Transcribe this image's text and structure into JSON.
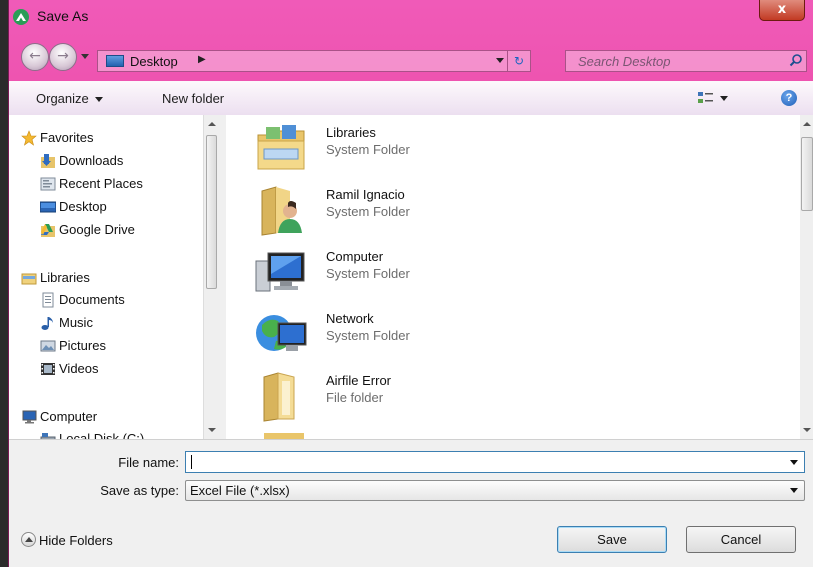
{
  "window": {
    "title": "Save As",
    "close_glyph": "x"
  },
  "navigation": {
    "back_glyph": "←",
    "forward_glyph": "→",
    "address": {
      "location": "Desktop",
      "separator": "▶",
      "icon": "desktop-icon"
    },
    "refresh_glyph": "↻",
    "search": {
      "placeholder": "Search Desktop"
    }
  },
  "toolbar": {
    "organize_label": "Organize",
    "new_folder_label": "New folder",
    "help_glyph": "?"
  },
  "nav_pane": {
    "items": [
      {
        "label": "Favorites",
        "icon": "star-icon",
        "level": 0
      },
      {
        "label": "Downloads",
        "icon": "downloads-folder-icon",
        "level": 1
      },
      {
        "label": "Recent Places",
        "icon": "recent-places-icon",
        "level": 1
      },
      {
        "label": "Desktop",
        "icon": "desktop-icon",
        "level": 1
      },
      {
        "label": "Google Drive",
        "icon": "google-drive-icon",
        "level": 1
      },
      {
        "label": "Libraries",
        "icon": "libraries-icon",
        "level": 0
      },
      {
        "label": "Documents",
        "icon": "documents-icon",
        "level": 1
      },
      {
        "label": "Music",
        "icon": "music-icon",
        "level": 1
      },
      {
        "label": "Pictures",
        "icon": "pictures-icon",
        "level": 1
      },
      {
        "label": "Videos",
        "icon": "videos-icon",
        "level": 1
      },
      {
        "label": "Computer",
        "icon": "computer-icon",
        "level": 0
      },
      {
        "label": "Local Disk (C:)",
        "icon": "local-disk-icon",
        "level": 1
      }
    ]
  },
  "files": [
    {
      "name": "Libraries",
      "type": "System Folder",
      "icon": "libraries-folder-icon"
    },
    {
      "name": "Ramil Ignacio",
      "type": "System Folder",
      "icon": "user-folder-icon"
    },
    {
      "name": "Computer",
      "type": "System Folder",
      "icon": "computer-icon"
    },
    {
      "name": "Network",
      "type": "System Folder",
      "icon": "network-icon"
    },
    {
      "name": "Airfile Error",
      "type": "File folder",
      "icon": "folder-icon"
    }
  ],
  "form": {
    "file_name_label": "File name:",
    "file_name_value": "",
    "save_as_type_label": "Save as type:",
    "save_as_type_value": "Excel File  (*.xlsx)"
  },
  "footer": {
    "hide_folders_label": "Hide Folders",
    "save_label": "Save",
    "cancel_label": "Cancel"
  }
}
